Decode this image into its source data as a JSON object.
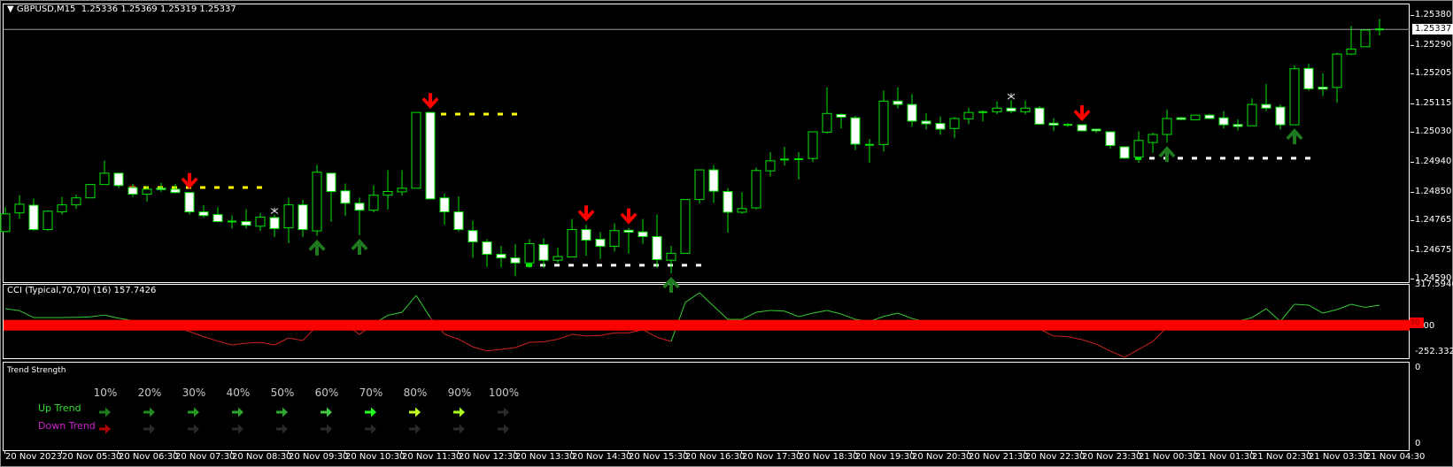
{
  "header": {
    "symbol": "GBPUSD,M15",
    "ohlc": "1.25336 1.25369 1.25319 1.25337"
  },
  "price_axis": {
    "labels": [
      "1.25380",
      "1.25290",
      "1.25205",
      "1.25115",
      "1.25030",
      "1.24940",
      "1.24850",
      "1.24765",
      "1.24675",
      "1.24590"
    ],
    "current_price": "1.25337"
  },
  "cci": {
    "title": "CCI (Typical,70,70) (16) 157.7426",
    "max_label": "317.5946",
    "zero_label": "0.00",
    "min_label": "-252.3322",
    "level_tag": "30",
    "max": 317.5946,
    "min": -252.3322
  },
  "trend_strength": {
    "title": "Trend Strength",
    "percents": [
      "10%",
      "20%",
      "30%",
      "40%",
      "50%",
      "60%",
      "70%",
      "80%",
      "90%",
      "100%"
    ],
    "up_label": "Up Trend",
    "down_label": "Down Trend",
    "up_colors": [
      "#1e7a1e",
      "#1f8c1f",
      "#219b21",
      "#2ea52e",
      "#2ea82e",
      "#3fc93f",
      "#22ff22",
      "#c4ff22",
      "#aaff22",
      "#2a2a2a"
    ],
    "down_colors": [
      "#b00000",
      "#2a2a2a",
      "#2a2a2a",
      "#2a2a2a",
      "#2a2a2a",
      "#2a2a2a",
      "#2a2a2a",
      "#2a2a2a",
      "#2a2a2a",
      "#2a2a2a"
    ],
    "up_label_color": "#33dd33",
    "down_label_color": "#cc22cc",
    "right_axis_labels": [
      "0",
      "0"
    ]
  },
  "time_axis": {
    "labels": [
      "20 Nov 2023",
      "20 Nov 05:30",
      "20 Nov 06:30",
      "20 Nov 07:30",
      "20 Nov 08:30",
      "20 Nov 09:30",
      "20 Nov 10:30",
      "20 Nov 11:30",
      "20 Nov 12:30",
      "20 Nov 13:30",
      "20 Nov 14:30",
      "20 Nov 15:30",
      "20 Nov 16:30",
      "20 Nov 17:30",
      "20 Nov 18:30",
      "20 Nov 19:30",
      "20 Nov 20:30",
      "20 Nov 21:30",
      "20 Nov 22:30",
      "20 Nov 23:30",
      "21 Nov 00:30",
      "21 Nov 01:30",
      "21 Nov 02:30",
      "21 Nov 03:30",
      "21 Nov 04:30"
    ]
  },
  "colors": {
    "candle": "#00e600",
    "bear_fill": "#ffffff",
    "sell_arrow": "#ff0000",
    "buy_arrow": "#1f7a1f",
    "resistance": "#ffff00",
    "support": "#ffffff",
    "cci_up": "#33cc33",
    "cci_down": "#cc2222",
    "band": "#ff0000"
  },
  "chart_data": {
    "type": "candlestick",
    "ylim": [
      1.2459,
      1.2538
    ],
    "candles": [
      [
        1.24731,
        1.24804,
        1.24729,
        1.24784
      ],
      [
        1.24787,
        1.2484,
        1.24769,
        1.24813
      ],
      [
        1.2481,
        1.2483,
        1.24733,
        1.24737
      ],
      [
        1.24737,
        1.24795,
        1.24733,
        1.24792
      ],
      [
        1.2479,
        1.24835,
        1.24782,
        1.24811
      ],
      [
        1.24811,
        1.24842,
        1.24799,
        1.24832
      ],
      [
        1.24832,
        1.24872,
        1.24832,
        1.24872
      ],
      [
        1.24872,
        1.24944,
        1.24872,
        1.24906
      ],
      [
        1.24906,
        1.24906,
        1.24861,
        1.24869
      ],
      [
        1.24863,
        1.24874,
        1.24835,
        1.24843
      ],
      [
        1.24843,
        1.24867,
        1.24821,
        1.24858
      ],
      [
        1.24861,
        1.24877,
        1.2485,
        1.24857
      ],
      [
        1.24858,
        1.24874,
        1.24845,
        1.24848
      ],
      [
        1.24848,
        1.24848,
        1.24782,
        1.2479
      ],
      [
        1.2479,
        1.2481,
        1.24773,
        1.24779
      ],
      [
        1.24782,
        1.24804,
        1.24759,
        1.24761
      ],
      [
        1.24761,
        1.2478,
        1.2474,
        1.24761
      ],
      [
        1.24761,
        1.24798,
        1.2474,
        1.2475
      ],
      [
        1.24747,
        1.24787,
        1.24733,
        1.24774
      ],
      [
        1.24773,
        1.24782,
        1.24715,
        1.2474
      ],
      [
        1.24742,
        1.24833,
        1.24696,
        1.24811
      ],
      [
        1.24811,
        1.24826,
        1.24715,
        1.24737
      ],
      [
        1.24733,
        1.24931,
        1.24718,
        1.24909
      ],
      [
        1.24906,
        1.24906,
        1.2476,
        1.24851
      ],
      [
        1.24853,
        1.24875,
        1.24778,
        1.24816
      ],
      [
        1.24816,
        1.24833,
        1.2472,
        1.24795
      ],
      [
        1.24795,
        1.2487,
        1.24789,
        1.2484
      ],
      [
        1.2484,
        1.24915,
        1.24797,
        1.24851
      ],
      [
        1.2485,
        1.24915,
        1.24839,
        1.24861
      ],
      [
        1.24861,
        1.25088,
        1.24861,
        1.25088
      ],
      [
        1.25088,
        1.25088,
        1.24828,
        1.24829
      ],
      [
        1.24832,
        1.24845,
        1.24751,
        1.2479
      ],
      [
        1.2479,
        1.24837,
        1.24731,
        1.24737
      ],
      [
        1.24734,
        1.24764,
        1.24652,
        1.247
      ],
      [
        1.247,
        1.24708,
        1.24625,
        1.24663
      ],
      [
        1.24663,
        1.24688,
        1.24623,
        1.24652
      ],
      [
        1.24652,
        1.24693,
        1.24597,
        1.24637
      ],
      [
        1.24637,
        1.24708,
        1.24622,
        1.24695
      ],
      [
        1.24692,
        1.24711,
        1.24622,
        1.24645
      ],
      [
        1.24645,
        1.24682,
        1.24637,
        1.24656
      ],
      [
        1.24655,
        1.24769,
        1.24655,
        1.24737
      ],
      [
        1.24737,
        1.24751,
        1.24659,
        1.24705
      ],
      [
        1.24708,
        1.2473,
        1.24649,
        1.24687
      ],
      [
        1.24687,
        1.24756,
        1.24671,
        1.24734
      ],
      [
        1.24735,
        1.24742,
        1.24665,
        1.24729
      ],
      [
        1.2473,
        1.24769,
        1.24694,
        1.24716
      ],
      [
        1.24716,
        1.24782,
        1.24622,
        1.24647
      ],
      [
        1.24645,
        1.24688,
        1.24606,
        1.24666
      ],
      [
        1.24666,
        1.24827,
        1.24666,
        1.24827
      ],
      [
        1.24827,
        1.24916,
        1.24815,
        1.24916
      ],
      [
        1.24916,
        1.2493,
        1.24817,
        1.24852
      ],
      [
        1.24851,
        1.24861,
        1.24728,
        1.24789
      ],
      [
        1.24789,
        1.24849,
        1.24784,
        1.248
      ],
      [
        1.24802,
        1.24923,
        1.24797,
        1.24914
      ],
      [
        1.24913,
        1.24969,
        1.24896,
        1.24943
      ],
      [
        1.24947,
        1.24985,
        1.24929,
        1.24947
      ],
      [
        1.24948,
        1.24969,
        1.24887,
        1.24948
      ],
      [
        1.2495,
        1.2503,
        1.24939,
        1.2503
      ],
      [
        1.25029,
        1.25163,
        1.25024,
        1.25085
      ],
      [
        1.25082,
        1.25085,
        1.2504,
        1.25074
      ],
      [
        1.25072,
        1.25078,
        1.24975,
        1.24993
      ],
      [
        1.24991,
        1.25009,
        1.24937,
        1.24991
      ],
      [
        1.24992,
        1.25154,
        1.24971,
        1.25122
      ],
      [
        1.25122,
        1.25163,
        1.251,
        1.25112
      ],
      [
        1.25112,
        1.25143,
        1.25045,
        1.25062
      ],
      [
        1.25062,
        1.25085,
        1.25037,
        1.25054
      ],
      [
        1.25055,
        1.25076,
        1.25021,
        1.25038
      ],
      [
        1.2504,
        1.25074,
        1.25011,
        1.2507
      ],
      [
        1.25069,
        1.25102,
        1.25053,
        1.25088
      ],
      [
        1.25089,
        1.25094,
        1.25061,
        1.25089
      ],
      [
        1.2509,
        1.25121,
        1.25083,
        1.25101
      ],
      [
        1.25101,
        1.25125,
        1.25085,
        1.25092
      ],
      [
        1.2509,
        1.25124,
        1.25082,
        1.25101
      ],
      [
        1.25101,
        1.25107,
        1.25051,
        1.25053
      ],
      [
        1.25056,
        1.25071,
        1.25032,
        1.2505
      ],
      [
        1.25051,
        1.25056,
        1.25045,
        1.25051
      ],
      [
        1.25051,
        1.25051,
        1.25031,
        1.25033
      ],
      [
        1.25038,
        1.25038,
        1.25026,
        1.25033
      ],
      [
        1.2503,
        1.2503,
        1.2498,
        1.24989
      ],
      [
        1.24985,
        1.24985,
        1.24949,
        1.24951
      ],
      [
        1.24954,
        1.25031,
        1.24937,
        1.25004
      ],
      [
        1.24998,
        1.25028,
        1.24967,
        1.25022
      ],
      [
        1.25022,
        1.25097,
        1.24998,
        1.2507
      ],
      [
        1.25072,
        1.25075,
        1.25065,
        1.25067
      ],
      [
        1.25066,
        1.2508,
        1.25066,
        1.2508
      ],
      [
        1.2508,
        1.25084,
        1.25068,
        1.2507
      ],
      [
        1.25072,
        1.25092,
        1.2504,
        1.25051
      ],
      [
        1.25052,
        1.25067,
        1.25034,
        1.25046
      ],
      [
        1.25048,
        1.2513,
        1.25048,
        1.25112
      ],
      [
        1.25112,
        1.25173,
        1.25092,
        1.25101
      ],
      [
        1.25104,
        1.25112,
        1.25037,
        1.25051
      ],
      [
        1.25051,
        1.2523,
        1.25051,
        1.25219
      ],
      [
        1.2522,
        1.25234,
        1.25153,
        1.25159
      ],
      [
        1.25164,
        1.25205,
        1.25137,
        1.25158
      ],
      [
        1.25163,
        1.25267,
        1.25117,
        1.25263
      ],
      [
        1.25263,
        1.25348,
        1.2526,
        1.25278
      ],
      [
        1.25285,
        1.25335,
        1.25285,
        1.25335
      ],
      [
        1.25336,
        1.25369,
        1.25319,
        1.25337
      ]
    ],
    "sell_signals": [
      13,
      30,
      41,
      44,
      76
    ],
    "buy_signals": [
      22,
      25,
      47,
      82,
      91
    ],
    "resistance_levels": [
      {
        "price": 1.24863,
        "from": 9,
        "to": 18
      },
      {
        "price": 1.25083,
        "from": 30,
        "to": 36
      }
    ],
    "support_levels": [
      {
        "price": 1.2463,
        "from": 37,
        "to": 49
      },
      {
        "price": 1.24951,
        "from": 80,
        "to": 92
      }
    ],
    "star_markers": [
      19,
      71
    ],
    "cci_values": [
      130,
      114,
      60,
      60,
      60,
      62,
      66,
      80,
      55,
      35,
      20,
      10,
      -10,
      -50,
      -90,
      -125,
      -155,
      -141,
      -135,
      -155,
      -100,
      -120,
      -5,
      10,
      5,
      -72,
      10,
      78,
      102,
      234,
      60,
      -70,
      -110,
      -170,
      -203,
      -190,
      -176,
      -134,
      -131,
      -110,
      -72,
      -85,
      -80,
      -60,
      -60,
      -35,
      -95,
      -127,
      180,
      255,
      150,
      46,
      46,
      102,
      116,
      111,
      67,
      95,
      116,
      88,
      46,
      30,
      69,
      95,
      53,
      25,
      15,
      20,
      10,
      5,
      0,
      -5,
      -10,
      -30,
      -85,
      -90,
      -113,
      -148,
      -203,
      -252,
      -190,
      -127,
      -15,
      10,
      15,
      10,
      20,
      30,
      60,
      130,
      30,
      165,
      158,
      95,
      123,
      165,
      140,
      157.74
    ],
    "cci_level": 0
  }
}
